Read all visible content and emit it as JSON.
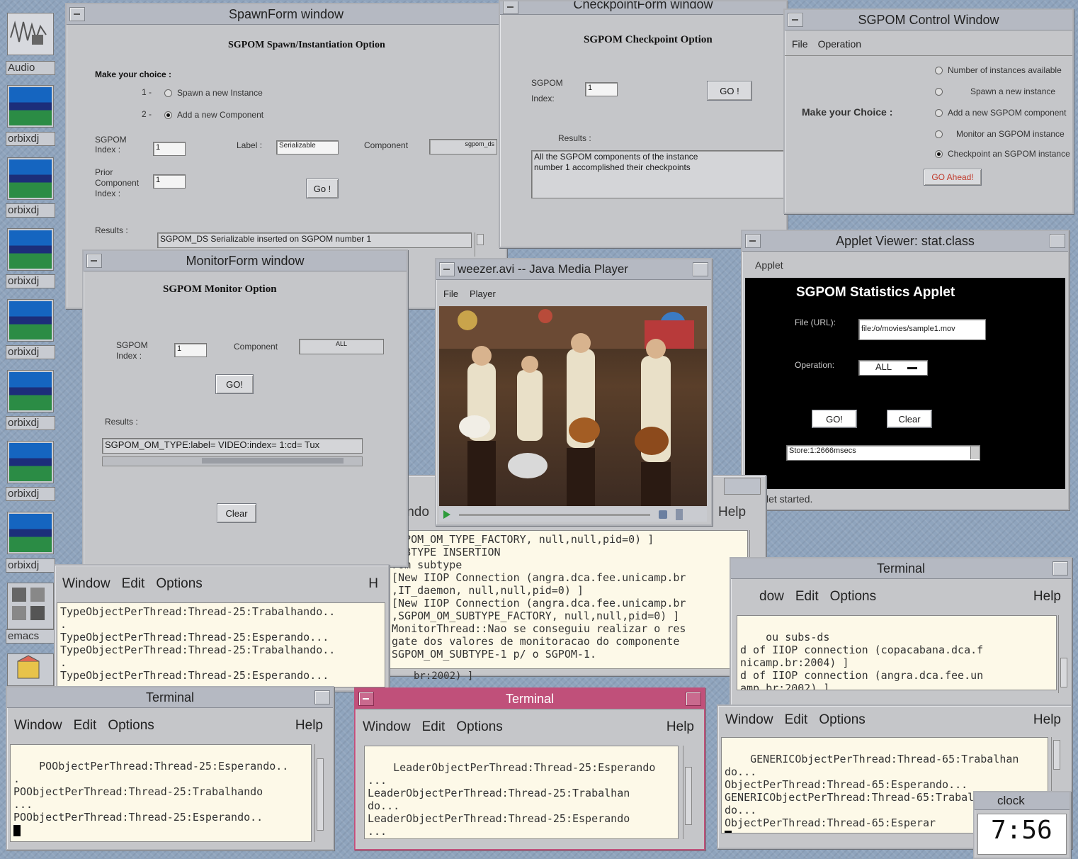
{
  "desktop": {
    "icons": [
      {
        "label": "Audio",
        "icon": "audio-waveform-icon"
      },
      {
        "label": "orbixdj",
        "icon": "terminal-screen-icon"
      },
      {
        "label": "orbixdj",
        "icon": "terminal-screen-icon"
      },
      {
        "label": "orbixdj",
        "icon": "terminal-screen-icon"
      },
      {
        "label": "orbixdj",
        "icon": "terminal-screen-icon"
      },
      {
        "label": "orbixdj",
        "icon": "terminal-screen-icon"
      },
      {
        "label": "orbixdj",
        "icon": "terminal-screen-icon"
      },
      {
        "label": "orbixdj",
        "icon": "terminal-screen-icon"
      },
      {
        "label": "emacs",
        "icon": "emacs-icon"
      }
    ]
  },
  "spawn": {
    "title": "SpawnForm window",
    "heading": "SGPOM Spawn/Instantiation Option",
    "choice_label": "Make your choice :",
    "opt1_num": "1 -",
    "opt1_text": "Spawn a new Instance",
    "opt2_num": "2 -",
    "opt2_text": "Add a new Component",
    "index_label": "SGPOM\nIndex :",
    "index_value": "1",
    "label_label": "Label :",
    "label_value": "Serializable",
    "component_label": "Component",
    "component_value": "sgpom_ds",
    "prior_label": "Prior\nComponent\nIndex :",
    "prior_value": "1",
    "go_label": "Go !",
    "results_label": "Results :",
    "results_value": "SGPOM_DS Serializable inserted on SGPOM number 1"
  },
  "checkpoint": {
    "title": "CheckpointForm window",
    "heading": "SGPOM Checkpoint Option",
    "index_label": "SGPOM\nIndex:",
    "index_value": "1",
    "go_label": "GO !",
    "results_label": "Results :",
    "results_value": "All the SGPOM components of the instance\nnumber 1 accomplished their checkpoints"
  },
  "control": {
    "title": "SGPOM Control Window",
    "menu": [
      "File",
      "Operation"
    ],
    "choice_label": "Make your Choice :",
    "options": [
      "Number of instances available",
      "Spawn a new instance",
      "Add a new SGPOM component",
      "Monitor an SGPOM instance",
      "Checkpoint an SGPOM instance"
    ],
    "go_label": "GO Ahead!"
  },
  "monitor": {
    "title": "MonitorForm window",
    "heading": "SGPOM Monitor Option",
    "index_label": "SGPOM\nIndex :",
    "index_value": "1",
    "component_label": "Component",
    "component_value": "ALL",
    "go_label": "GO!",
    "results_label": "Results :",
    "results_value": "SGPOM_OM_TYPE:label= VIDEO:index= 1:cd= Tux",
    "clear_label": "Clear"
  },
  "player": {
    "title": "weezer.avi -- Java Media Player",
    "menu": [
      "File",
      "Player"
    ],
    "video_desc": "band-performing-video-frame"
  },
  "applet": {
    "title": "Applet Viewer: stat.class",
    "menu": "Applet",
    "heading": "SGPOM Statistics Applet",
    "file_label": "File (URL):",
    "file_value": "file:/o/movies/sample1.mov",
    "operation_label": "Operation:",
    "operation_value": "ALL",
    "go_label": "GO!",
    "clear_label": "Clear",
    "store_value": "Store:1:2666msecs",
    "status": "let started."
  },
  "center_term": {
    "partial_title": "indo",
    "help": "Help",
    "lines": "SGPOM_OM_TYPE_FACTORY, null,null,pid=0) ]\nSUBTYPE INSERTION\nrom subtype\n[New IIOP Connection (angra.dca.fee.unicamp.br\n,IT_daemon, null,null,pid=0) ]\n[New IIOP Connection (angra.dca.fee.unicamp.br\n,SGPOM_OM_SUBTYPE_FACTORY, null,null,pid=0) ]\nMonitorThread::Nao se conseguiu realizar o res\ngate dos valores de monitoracao do componente\nSGPOM_OM_SUBTYPE-1 p/ o SGPOM-1."
  },
  "left_term": {
    "menu": [
      "Window",
      "Edit",
      "Options"
    ],
    "help": "H",
    "lines": "TypeObjectPerThread:Thread-25:Trabalhando..\n.\nTypeObjectPerThread:Thread-25:Esperando...\nTypeObjectPerThread:Thread-25:Trabalhando..\n.\nTypeObjectPerThread:Thread-25:Esperando...",
    "tail": "br:2002) ]"
  },
  "right_term": {
    "title": "Terminal",
    "menu": [
      "dow",
      "Edit",
      "Options"
    ],
    "help": "Help",
    "lines": "ou subs-ds\nd of IIOP connection (copacabana.dca.f\nnicamp.br:2004) ]\nd of IIOP connection (angra.dca.fee.un\namp.br:2002) ]"
  },
  "term_bl": {
    "title": "Terminal",
    "menu": [
      "Window",
      "Edit",
      "Options"
    ],
    "help": "Help",
    "lines": "POObjectPerThread:Thread-25:Esperando..\n.\nPOObjectPerThread:Thread-25:Trabalhando\n...\nPOObjectPerThread:Thread-25:Esperando.."
  },
  "term_bm": {
    "title": "Terminal",
    "menu": [
      "Window",
      "Edit",
      "Options"
    ],
    "help": "Help",
    "lines": "LeaderObjectPerThread:Thread-25:Esperando\n...\nLeaderObjectPerThread:Thread-25:Trabalhan\ndo...\nLeaderObjectPerThread:Thread-25:Esperando\n..."
  },
  "term_br": {
    "menu": [
      "Window",
      "Edit",
      "Options"
    ],
    "help": "Help",
    "lines": "GENERICObjectPerThread:Thread-65:Trabalhan\ndo...\nObjectPerThread:Thread-65:Esperando...\nGENERICObjectPerThread:Thread-65:Trabalhan\ndo...\nObjectPerThread:Thread-65:Esperar"
  },
  "clock": {
    "title": "clock",
    "time": "7:56"
  },
  "colors": {
    "desktop": "#8fa4bd",
    "window_bg": "#c5c6c9",
    "active_title": "#c0507a",
    "terminal_bg": "#fdf9e8",
    "applet_bg": "#000000"
  }
}
